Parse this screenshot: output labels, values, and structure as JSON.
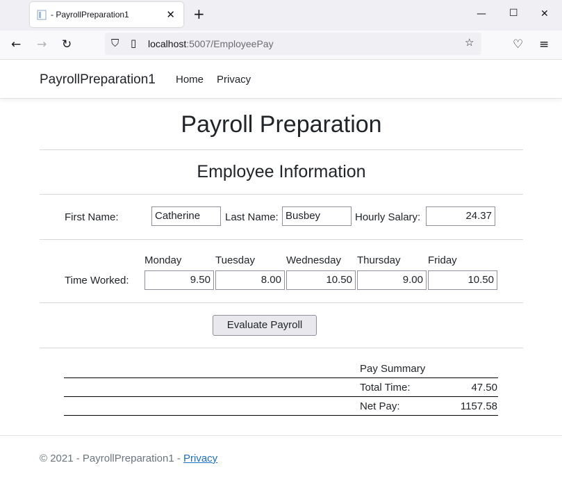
{
  "browser": {
    "tab_title": "- PayrollPreparation1",
    "url_host": "localhost",
    "url_rest": ":5007/EmployeePay"
  },
  "site": {
    "brand": "PayrollPreparation1",
    "nav": [
      "Home",
      "Privacy"
    ]
  },
  "page": {
    "title": "Payroll Preparation",
    "section_title": "Employee Information"
  },
  "employee": {
    "first_name_label": "First Name:",
    "first_name": "Catherine",
    "last_name_label": "Last Name:",
    "last_name": "Busbey",
    "hourly_salary_label": "Hourly Salary:",
    "hourly_salary": "24.37"
  },
  "time": {
    "label": "Time Worked:",
    "days": [
      {
        "day": "Monday",
        "hours": "9.50"
      },
      {
        "day": "Tuesday",
        "hours": "8.00"
      },
      {
        "day": "Wednesday",
        "hours": "10.50"
      },
      {
        "day": "Thursday",
        "hours": "9.00"
      },
      {
        "day": "Friday",
        "hours": "10.50"
      }
    ]
  },
  "evaluate_label": "Evaluate Payroll",
  "summary": {
    "heading": "Pay Summary",
    "total_time_label": "Total Time:",
    "total_time": "47.50",
    "net_pay_label": "Net Pay:",
    "net_pay": "1157.58"
  },
  "footer": {
    "text": "© 2021 - PayrollPreparation1 - ",
    "link": "Privacy"
  }
}
